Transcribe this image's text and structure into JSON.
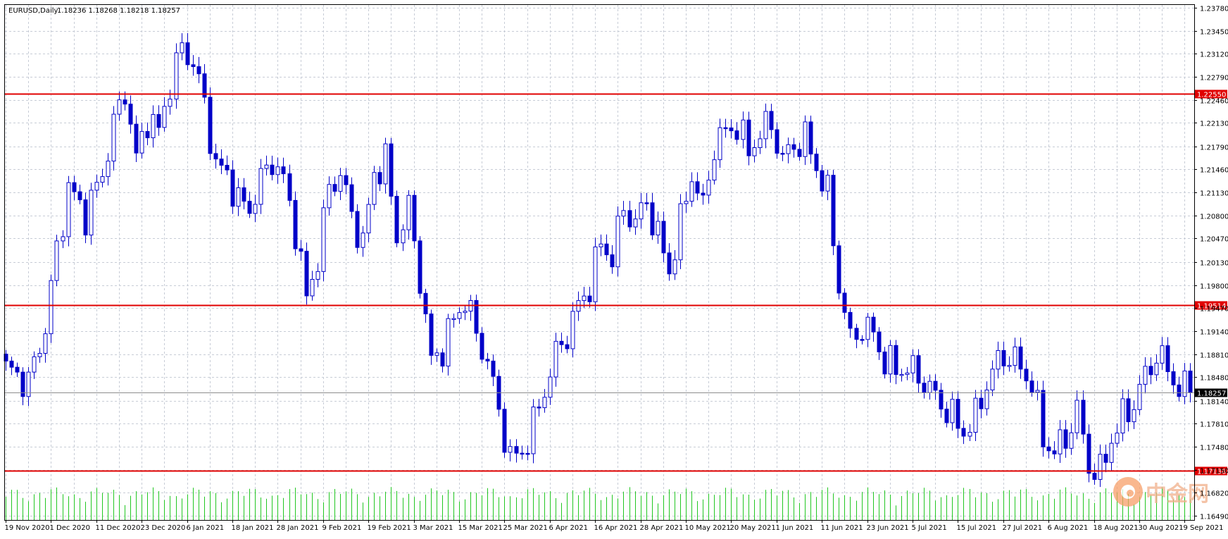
{
  "header": {
    "symbol_text": "EURUSD,Daily",
    "ohlc_text": "1.18236 1.18268 1.18218 1.18257"
  },
  "watermark": {
    "text": "中金网"
  },
  "colors": {
    "background": "#ffffff",
    "grid": "#c7ccd6",
    "candle": "#0000c8",
    "volume": "#22c722",
    "level_line": "#e00000",
    "level_tag_bg": "#e00000",
    "current_line": "#8c8c8c",
    "current_tag_bg": "#000000",
    "border": "#000000"
  },
  "chart_data": {
    "type": "candlestick",
    "symbol": "EURUSD",
    "timeframe": "Daily",
    "ylim": [
      1.1649,
      1.2378
    ],
    "y_ticks": [
      "1.23780",
      "1.23450",
      "1.23120",
      "1.22790",
      "1.22460",
      "1.22130",
      "1.21790",
      "1.21460",
      "1.21130",
      "1.20800",
      "1.20470",
      "1.20130",
      "1.19800",
      "1.19470",
      "1.19140",
      "1.18810",
      "1.18480",
      "1.18140",
      "1.17810",
      "1.17480",
      "1.17150",
      "1.16820",
      "1.16490"
    ],
    "x_ticks": [
      {
        "label": "19 Nov 2020",
        "index": 0
      },
      {
        "label": "1 Dec 2020",
        "index": 8
      },
      {
        "label": "11 Dec 2020",
        "index": 16
      },
      {
        "label": "23 Dec 2020",
        "index": 24
      },
      {
        "label": "6 Jan 2021",
        "index": 32
      },
      {
        "label": "18 Jan 2021",
        "index": 40
      },
      {
        "label": "28 Jan 2021",
        "index": 48
      },
      {
        "label": "9 Feb 2021",
        "index": 56
      },
      {
        "label": "19 Feb 2021",
        "index": 64
      },
      {
        "label": "3 Mar 2021",
        "index": 72
      },
      {
        "label": "15 Mar 2021",
        "index": 80
      },
      {
        "label": "25 Mar 2021",
        "index": 88
      },
      {
        "label": "6 Apr 2021",
        "index": 96
      },
      {
        "label": "16 Apr 2021",
        "index": 104
      },
      {
        "label": "28 Apr 2021",
        "index": 112
      },
      {
        "label": "10 May 2021",
        "index": 120
      },
      {
        "label": "20 May 2021",
        "index": 128
      },
      {
        "label": "1 Jun 2021",
        "index": 136
      },
      {
        "label": "11 Jun 2021",
        "index": 144
      },
      {
        "label": "23 Jun 2021",
        "index": 152
      },
      {
        "label": "5 Jul 2021",
        "index": 160
      },
      {
        "label": "15 Jul 2021",
        "index": 168
      },
      {
        "label": "27 Jul 2021",
        "index": 176
      },
      {
        "label": "6 Aug 2021",
        "index": 184
      },
      {
        "label": "18 Aug 2021",
        "index": 192
      },
      {
        "label": "30 Aug 2021",
        "index": 200
      },
      {
        "label": "9 Sep 2021",
        "index": 208
      }
    ],
    "levels": [
      {
        "label": "1.22550",
        "value": 1.2255
      },
      {
        "label": "1.19514",
        "value": 1.19514
      },
      {
        "label": "1.17138",
        "value": 1.17138
      }
    ],
    "current_price": {
      "label": "1.18257",
      "value": 1.18257
    },
    "anchors": [
      [
        0,
        1.186
      ],
      [
        4,
        1.184
      ],
      [
        7,
        1.192
      ],
      [
        9,
        1.203
      ],
      [
        11,
        1.212
      ],
      [
        14,
        1.208
      ],
      [
        17,
        1.214
      ],
      [
        19,
        1.221
      ],
      [
        21,
        1.226
      ],
      [
        23,
        1.216
      ],
      [
        25,
        1.222
      ],
      [
        27,
        1.22
      ],
      [
        29,
        1.227
      ],
      [
        31,
        1.232
      ],
      [
        33,
        1.23
      ],
      [
        35,
        1.224
      ],
      [
        37,
        1.215
      ],
      [
        39,
        1.214
      ],
      [
        41,
        1.21
      ],
      [
        43,
        1.209
      ],
      [
        45,
        1.213
      ],
      [
        47,
        1.216
      ],
      [
        49,
        1.213
      ],
      [
        51,
        1.206
      ],
      [
        53,
        1.196
      ],
      [
        55,
        1.202
      ],
      [
        57,
        1.212
      ],
      [
        59,
        1.214
      ],
      [
        61,
        1.208
      ],
      [
        63,
        1.204
      ],
      [
        65,
        1.214
      ],
      [
        67,
        1.216
      ],
      [
        69,
        1.205
      ],
      [
        71,
        1.209
      ],
      [
        73,
        1.199
      ],
      [
        75,
        1.187
      ],
      [
        77,
        1.189
      ],
      [
        79,
        1.193
      ],
      [
        81,
        1.196
      ],
      [
        83,
        1.191
      ],
      [
        85,
        1.187
      ],
      [
        87,
        1.18
      ],
      [
        89,
        1.173
      ],
      [
        91,
        1.174
      ],
      [
        93,
        1.178
      ],
      [
        95,
        1.183
      ],
      [
        97,
        1.188
      ],
      [
        99,
        1.191
      ],
      [
        101,
        1.195
      ],
      [
        103,
        1.198
      ],
      [
        105,
        1.204
      ],
      [
        107,
        1.202
      ],
      [
        109,
        1.209
      ],
      [
        111,
        1.207
      ],
      [
        113,
        1.21
      ],
      [
        115,
        1.205
      ],
      [
        117,
        1.2
      ],
      [
        119,
        1.207
      ],
      [
        121,
        1.214
      ],
      [
        123,
        1.209
      ],
      [
        125,
        1.218
      ],
      [
        127,
        1.22
      ],
      [
        129,
        1.221
      ],
      [
        131,
        1.217
      ],
      [
        133,
        1.22
      ],
      [
        135,
        1.221
      ],
      [
        137,
        1.216
      ],
      [
        139,
        1.218
      ],
      [
        141,
        1.219
      ],
      [
        143,
        1.215
      ],
      [
        145,
        1.211
      ],
      [
        147,
        1.198
      ],
      [
        149,
        1.19
      ],
      [
        151,
        1.192
      ],
      [
        153,
        1.191
      ],
      [
        155,
        1.187
      ],
      [
        157,
        1.186
      ],
      [
        159,
        1.186
      ],
      [
        161,
        1.185
      ],
      [
        163,
        1.183
      ],
      [
        165,
        1.181
      ],
      [
        167,
        1.179
      ],
      [
        169,
        1.177
      ],
      [
        171,
        1.179
      ],
      [
        173,
        1.184
      ],
      [
        175,
        1.187
      ],
      [
        177,
        1.188
      ],
      [
        179,
        1.186
      ],
      [
        181,
        1.184
      ],
      [
        183,
        1.176
      ],
      [
        185,
        1.174
      ],
      [
        187,
        1.176
      ],
      [
        189,
        1.18
      ],
      [
        191,
        1.172
      ],
      [
        193,
        1.171
      ],
      [
        195,
        1.176
      ],
      [
        197,
        1.179
      ],
      [
        199,
        1.181
      ],
      [
        201,
        1.185
      ],
      [
        203,
        1.188
      ],
      [
        205,
        1.186
      ],
      [
        207,
        1.183
      ],
      [
        209,
        1.1826
      ]
    ],
    "volume_ylim": [
      0,
      1
    ]
  }
}
